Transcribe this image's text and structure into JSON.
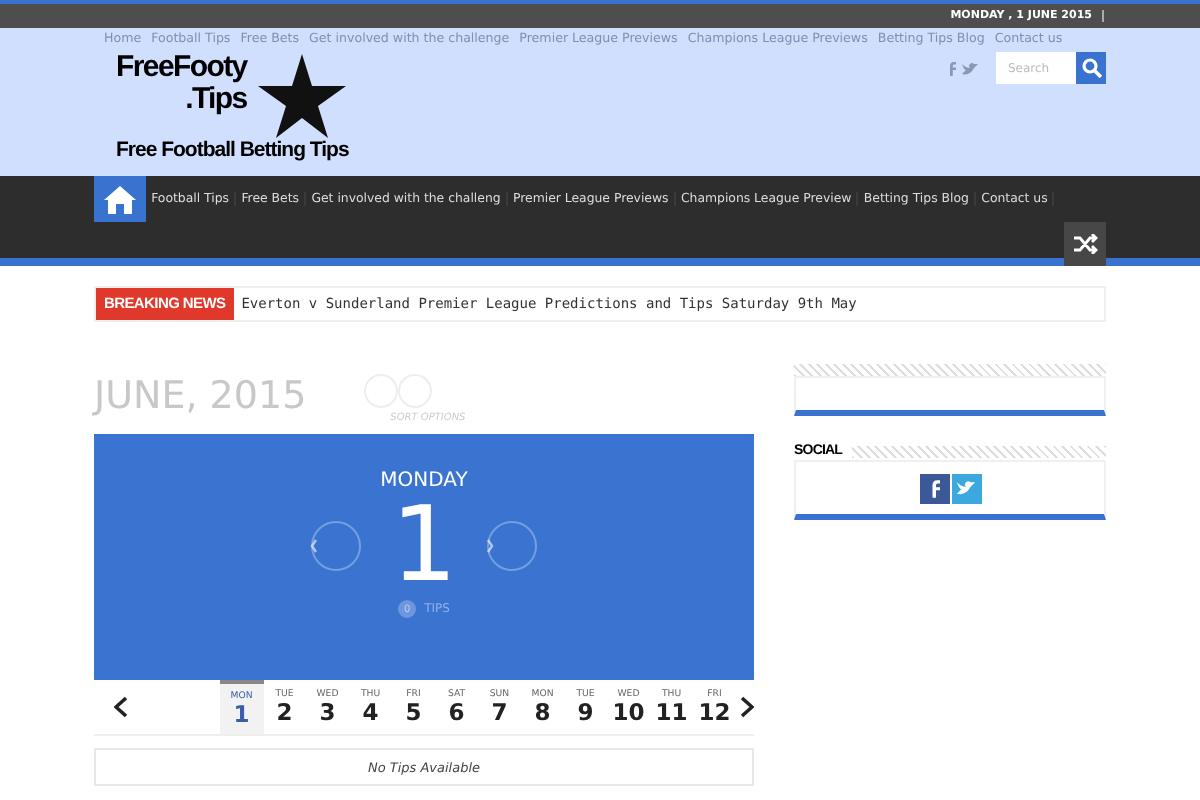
{
  "top_bar": {
    "date": "MONDAY , 1 JUNE 2015"
  },
  "top_nav": [
    "Home",
    "Football Tips",
    "Free Bets",
    "Get involved with the challenge",
    "Premier League Previews",
    "Champions League Previews",
    "Betting Tips Blog",
    "Contact us"
  ],
  "logo": {
    "line_1": "FreeFooty",
    "line_2": ".Tips",
    "tagline": "Free Football Betting Tips"
  },
  "search": {
    "placeholder": "Search"
  },
  "main_nav": [
    {
      "label": "Football Tips",
      "selected": false
    },
    {
      "label": "Free Bets",
      "selected": false
    },
    {
      "label": "Get involved with the challeng",
      "selected": false
    },
    {
      "label": "Premier League Previews",
      "selected": false
    },
    {
      "label": "Champions League Preview",
      "selected": false
    },
    {
      "label": "Betting Tips Blog",
      "selected": false
    },
    {
      "label": "Contact us",
      "selected": false
    }
  ],
  "home_selected": true,
  "breaking_news": {
    "label": "BREAKING NEWS",
    "headline": "Everton v Sunderland Premier League Predictions and Tips Saturday 9th May"
  },
  "calendar": {
    "month": "JUNE, 2015",
    "sort_label": "SORT OPTIONS",
    "weekday": "MONDAY",
    "day": "1",
    "tips_count": "0",
    "tips_label": "TIPS",
    "days": [
      {
        "dow": "MON",
        "num": "1",
        "selected": true
      },
      {
        "dow": "TUE",
        "num": "2",
        "selected": false
      },
      {
        "dow": "WED",
        "num": "3",
        "selected": false
      },
      {
        "dow": "THU",
        "num": "4",
        "selected": false
      },
      {
        "dow": "FRI",
        "num": "5",
        "selected": false
      },
      {
        "dow": "SAT",
        "num": "6",
        "selected": false
      },
      {
        "dow": "SUN",
        "num": "7",
        "selected": false
      },
      {
        "dow": "MON",
        "num": "8",
        "selected": false
      },
      {
        "dow": "TUE",
        "num": "9",
        "selected": false
      },
      {
        "dow": "WED",
        "num": "10",
        "selected": false
      },
      {
        "dow": "THU",
        "num": "11",
        "selected": false
      },
      {
        "dow": "FRI",
        "num": "12",
        "selected": false
      }
    ],
    "empty_message": "No Tips Available"
  },
  "sidebar": {
    "social_title": "SOCIAL"
  }
}
